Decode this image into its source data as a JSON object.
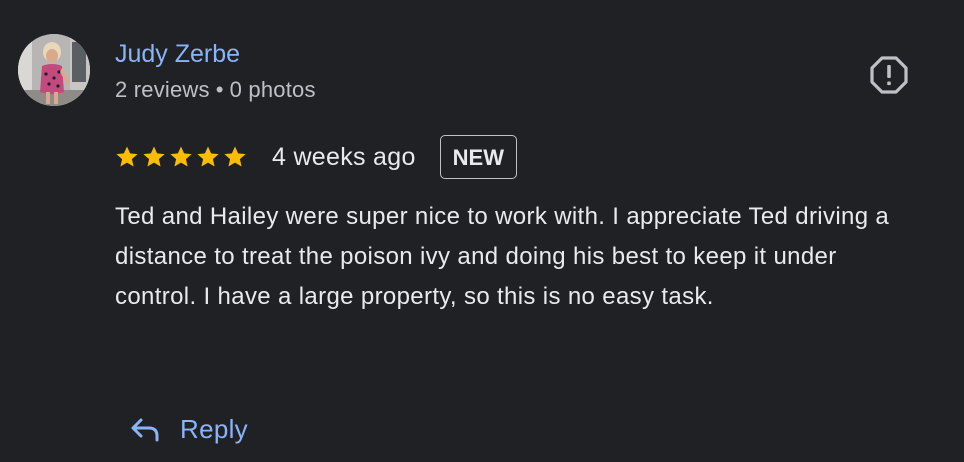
{
  "review": {
    "author": {
      "name": "Judy Zerbe",
      "reviews_count": "2 reviews",
      "separator": "•",
      "photos_count": "0 photos"
    },
    "rating": 5,
    "date": "4 weeks ago",
    "badge": "NEW",
    "text": "Ted and Hailey were super nice to work with. I appreciate Ted driving a distance to treat the poison ivy and doing his best to keep it under control. I have a large property, so this is no easy task.",
    "actions": {
      "reply_label": "Reply"
    }
  },
  "icons": {
    "report": "report-flag-icon",
    "star": "star-icon",
    "reply": "reply-arrow-icon"
  },
  "colors": {
    "background": "#202124",
    "link_blue": "#8ab4f8",
    "star_yellow": "#fbbc04",
    "text_primary": "#e8eaed",
    "text_secondary": "#bdc1c6"
  }
}
